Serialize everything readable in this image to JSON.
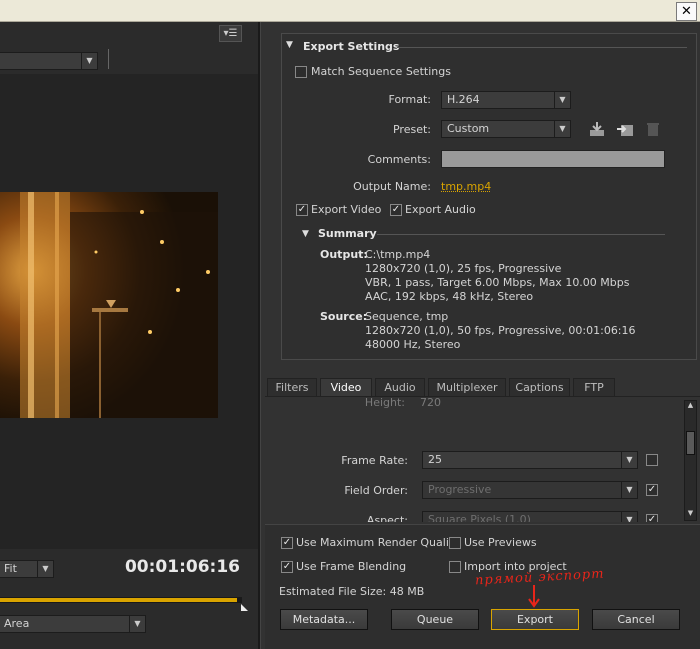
{
  "window": {
    "close_glyph": "✕"
  },
  "left": {
    "source_dropdown": "",
    "fit_dropdown": "Fit",
    "timecode": "00:01:06:16",
    "area_dropdown": "Area",
    "progress": 0.98,
    "menu_icon": "menu-icon"
  },
  "export_settings": {
    "title": "Export Settings",
    "match_sequence": "Match Sequence Settings",
    "format_label": "Format:",
    "format_value": "H.264",
    "preset_label": "Preset:",
    "preset_value": "Custom",
    "comments_label": "Comments:",
    "comments_value": "",
    "output_name_label": "Output Name:",
    "output_name_value": "tmp.mp4",
    "export_video": "Export Video",
    "export_audio": "Export Audio",
    "summary_title": "Summary",
    "output_label": "Output:",
    "output_lines": [
      "C:\\tmp.mp4",
      "1280x720 (1,0), 25 fps, Progressive",
      "VBR, 1 pass, Target 6.00 Mbps, Max 10.00 Mbps",
      "AAC, 192 kbps, 48 kHz, Stereo"
    ],
    "source_label": "Source:",
    "source_lines": [
      "Sequence, tmp",
      "1280x720 (1,0), 50 fps, Progressive, 00:01:06:16",
      "48000 Hz, Stereo"
    ]
  },
  "tabs": [
    "Filters",
    "Video",
    "Audio",
    "Multiplexer",
    "Captions",
    "FTP"
  ],
  "video": {
    "height_label": "Height:",
    "height_value": "720",
    "frame_rate_label": "Frame Rate:",
    "frame_rate_value": "25",
    "field_order_label": "Field Order:",
    "field_order_value": "Progressive",
    "aspect_label": "Aspect:",
    "aspect_value": "Square Pixels (1.0)"
  },
  "bottom": {
    "max_render": "Use Maximum Render Quality",
    "use_previews": "Use Previews",
    "frame_blending": "Use Frame Blending",
    "import_project": "Import into project",
    "file_size": "Estimated File Size:  48 MB",
    "annotation": "прямой экспорт",
    "metadata_btn": "Metadata...",
    "queue_btn": "Queue",
    "export_btn": "Export",
    "cancel_btn": "Cancel"
  },
  "colors": {
    "accent": "#d9a400",
    "annotation": "#e8251a",
    "bg": "#323232"
  }
}
